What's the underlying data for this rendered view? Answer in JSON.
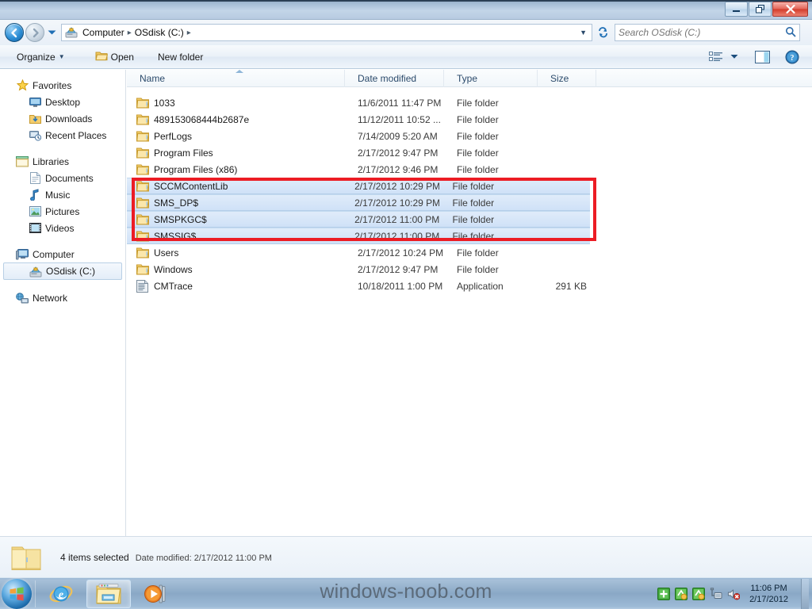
{
  "window": {
    "controls": {
      "minimize": "minimize-icon",
      "restore": "restore-icon",
      "close": "close-icon"
    }
  },
  "address": {
    "back_label": "Back",
    "forward_label": "Forward",
    "recent_label": "Recent pages",
    "icon": "drive-icon",
    "crumbs": [
      "Computer",
      "OSdisk (C:)"
    ],
    "separator": "▸",
    "dropdown": "▼",
    "refresh_icon": "refresh-icon"
  },
  "search": {
    "placeholder": "Search OSdisk (C:)",
    "value": "",
    "icon": "search-icon"
  },
  "toolbar": {
    "organize": "Organize",
    "organize_caret": "▼",
    "open": "Open",
    "new_folder": "New folder",
    "view_icon": "view-list-icon",
    "view_caret": "▼",
    "preview_icon": "preview-pane-icon",
    "help_icon": "help-icon"
  },
  "navpane": {
    "groups": [
      {
        "header": {
          "label": "Favorites",
          "icon": "star-icon"
        },
        "items": [
          {
            "label": "Desktop",
            "icon": "desktop-icon"
          },
          {
            "label": "Downloads",
            "icon": "downloads-icon"
          },
          {
            "label": "Recent Places",
            "icon": "recent-places-icon"
          }
        ]
      },
      {
        "header": {
          "label": "Libraries",
          "icon": "libraries-icon"
        },
        "items": [
          {
            "label": "Documents",
            "icon": "documents-icon"
          },
          {
            "label": "Music",
            "icon": "music-icon"
          },
          {
            "label": "Pictures",
            "icon": "pictures-icon"
          },
          {
            "label": "Videos",
            "icon": "videos-icon"
          }
        ]
      },
      {
        "header": {
          "label": "Computer",
          "icon": "computer-icon"
        },
        "items": [
          {
            "label": "OSdisk (C:)",
            "icon": "drive-icon",
            "selected": true
          }
        ]
      },
      {
        "header": {
          "label": "Network",
          "icon": "network-icon"
        },
        "items": []
      }
    ]
  },
  "list": {
    "columns": [
      {
        "key": "name",
        "label": "Name",
        "sorted": true
      },
      {
        "key": "date",
        "label": "Date modified"
      },
      {
        "key": "type",
        "label": "Type"
      },
      {
        "key": "size",
        "label": "Size"
      }
    ],
    "rows": [
      {
        "name": "1033",
        "date": "11/6/2011 11:47 PM",
        "type": "File folder",
        "size": "",
        "icon": "folder-icon",
        "selected": false
      },
      {
        "name": "489153068444b2687e",
        "date": "11/12/2011 10:52 ...",
        "type": "File folder",
        "size": "",
        "icon": "folder-icon",
        "selected": false
      },
      {
        "name": "PerfLogs",
        "date": "7/14/2009 5:20 AM",
        "type": "File folder",
        "size": "",
        "icon": "folder-icon",
        "selected": false
      },
      {
        "name": "Program Files",
        "date": "2/17/2012 9:47 PM",
        "type": "File folder",
        "size": "",
        "icon": "folder-icon",
        "selected": false
      },
      {
        "name": "Program Files (x86)",
        "date": "2/17/2012 9:46 PM",
        "type": "File folder",
        "size": "",
        "icon": "folder-icon",
        "selected": false
      },
      {
        "name": "SCCMContentLib",
        "date": "2/17/2012 10:29 PM",
        "type": "File folder",
        "size": "",
        "icon": "folder-icon",
        "selected": true
      },
      {
        "name": "SMS_DP$",
        "date": "2/17/2012 10:29 PM",
        "type": "File folder",
        "size": "",
        "icon": "folder-icon",
        "selected": true
      },
      {
        "name": "SMSPKGC$",
        "date": "2/17/2012 11:00 PM",
        "type": "File folder",
        "size": "",
        "icon": "folder-icon",
        "selected": true
      },
      {
        "name": "SMSSIG$",
        "date": "2/17/2012 11:00 PM",
        "type": "File folder",
        "size": "",
        "icon": "folder-icon",
        "selected": true
      },
      {
        "name": "Users",
        "date": "2/17/2012 10:24 PM",
        "type": "File folder",
        "size": "",
        "icon": "folder-icon",
        "selected": false
      },
      {
        "name": "Windows",
        "date": "2/17/2012 9:47 PM",
        "type": "File folder",
        "size": "",
        "icon": "folder-icon",
        "selected": false
      },
      {
        "name": "CMTrace",
        "date": "10/18/2011 1:00 PM",
        "type": "Application",
        "size": "291 KB",
        "icon": "application-icon",
        "selected": false
      }
    ]
  },
  "annotation": {
    "color": "#ec1c24"
  },
  "status": {
    "icon": "folder-icon",
    "selection": "4 items selected",
    "detail": "Date modified: 2/17/2012 11:00 PM"
  },
  "taskbar": {
    "start": "start-orb-icon",
    "apps": [
      {
        "name": "internet-explorer-icon",
        "active": false
      },
      {
        "name": "windows-explorer-icon",
        "active": true
      },
      {
        "name": "windows-media-player-icon",
        "active": false
      }
    ],
    "watermark": "windows-noob.com",
    "tray": [
      {
        "name": "tray-shield-icon"
      },
      {
        "name": "tray-network-activity-icon"
      },
      {
        "name": "tray-network-activity-2-icon"
      },
      {
        "name": "tray-network-icon"
      },
      {
        "name": "tray-volume-muted-icon"
      }
    ],
    "clock_time": "11:06 PM",
    "clock_date": "2/17/2012"
  }
}
